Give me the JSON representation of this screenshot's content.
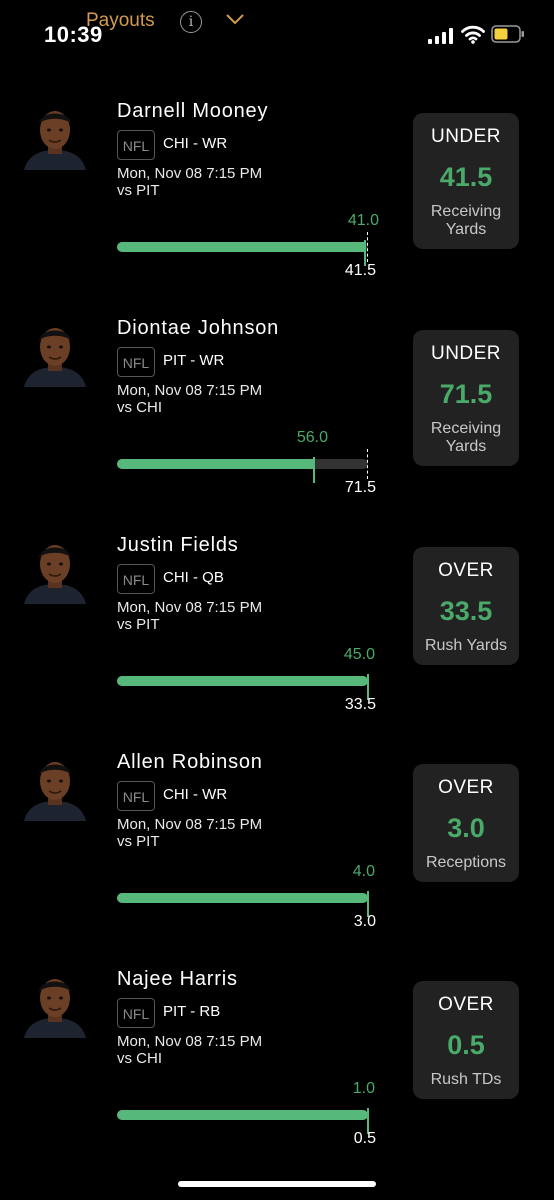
{
  "status_bar": {
    "time": "10:39"
  },
  "header": {
    "payouts_label": "Payouts",
    "info_icon": "i"
  },
  "colors": {
    "accent_green": "#56b87a",
    "payouts_orange": "#d39b4e",
    "card_bg": "#222222"
  },
  "picks": [
    {
      "player": "Darnell Mooney",
      "league": "NFL",
      "team_pos": "CHI - WR",
      "game_time": "Mon, Nov 08 7:15 PM",
      "opponent": "vs PIT",
      "actual": "41.0",
      "line": "41.5",
      "progress": 0.989,
      "direction": "UNDER",
      "value": "41.5",
      "stat": "Receiving Yards"
    },
    {
      "player": "Diontae Johnson",
      "league": "NFL",
      "team_pos": "PIT - WR",
      "game_time": "Mon, Nov 08 7:15 PM",
      "opponent": "vs CHI",
      "actual": "56.0",
      "line": "71.5",
      "progress": 0.783,
      "direction": "UNDER",
      "value": "71.5",
      "stat": "Receiving Yards"
    },
    {
      "player": "Justin Fields",
      "league": "NFL",
      "team_pos": "CHI - QB",
      "game_time": "Mon, Nov 08 7:15 PM",
      "opponent": "vs PIT",
      "actual": "45.0",
      "line": "33.5",
      "progress": 1.0,
      "direction": "OVER",
      "value": "33.5",
      "stat": "Rush Yards"
    },
    {
      "player": "Allen Robinson",
      "league": "NFL",
      "team_pos": "CHI - WR",
      "game_time": "Mon, Nov 08 7:15 PM",
      "opponent": "vs PIT",
      "actual": "4.0",
      "line": "3.0",
      "progress": 1.0,
      "direction": "OVER",
      "value": "3.0",
      "stat": "Receptions"
    },
    {
      "player": "Najee Harris",
      "league": "NFL",
      "team_pos": "PIT - RB",
      "game_time": "Mon, Nov 08 7:15 PM",
      "opponent": "vs CHI",
      "actual": "1.0",
      "line": "0.5",
      "progress": 1.0,
      "direction": "OVER",
      "value": "0.5",
      "stat": "Rush TDs"
    }
  ]
}
